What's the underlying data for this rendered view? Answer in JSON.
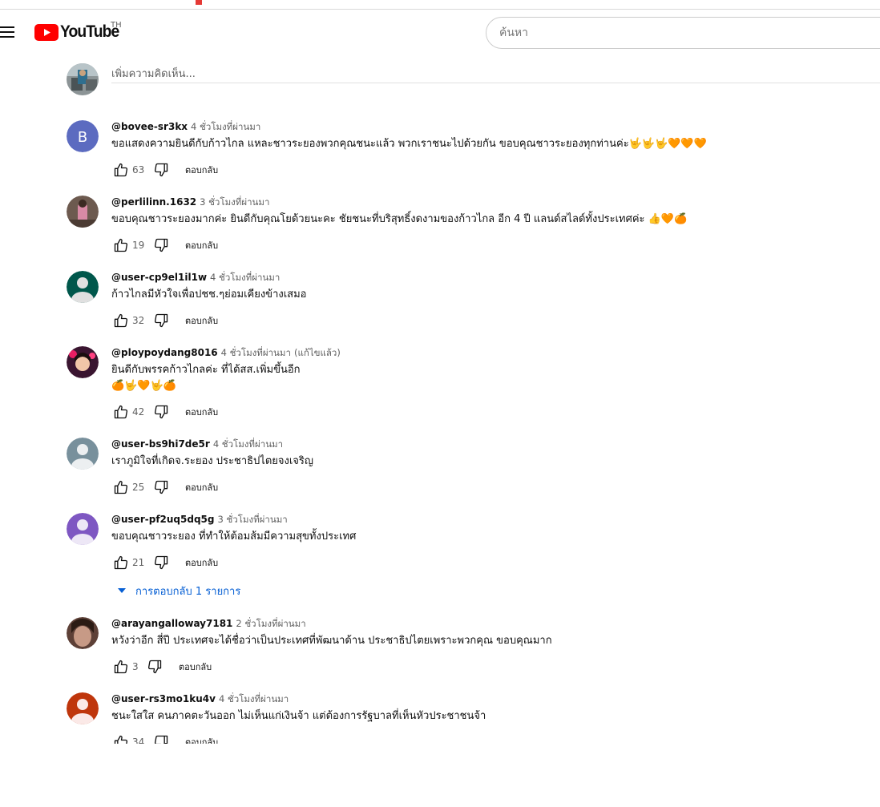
{
  "masthead": {
    "logo_text": "YouTube",
    "country": "TH",
    "search_placeholder": "ค้นหา"
  },
  "add_comment": {
    "placeholder": "เพิ่มความคิดเห็น..."
  },
  "reply_label": "ตอบกลับ",
  "comments": [
    {
      "author": "@bovee-sr3kx",
      "time": "4 ชั่วโมงที่ผ่านมา",
      "avatar_letter": "B",
      "avatar_color": "#5c6bc0",
      "text": "ขอแสดงความยินดีกับก้าวไกล แหละชาวระยองพวกคุณชนะแล้ว พวกเราชนะไปด้วยกัน ขอบคุณชาวระยองทุกท่านค่ะ🤟🤟🤟🧡🧡🧡",
      "likes": "63"
    },
    {
      "author": "@perlilinn.1632",
      "time": "3 ชั่วโมงที่ผ่านมา",
      "avatar_color": "#8d6e63",
      "text": "ขอบคุณชาวระยองมากค่ะ ยินดีกับคุณโยด้วยนะคะ ชัยชนะที่บริสุทธิ์งดงามของก้าวไกล อีก 4 ปี แลนด์สไลด์ทั้งประเทศค่ะ 👍🧡🍊",
      "likes": "19"
    },
    {
      "author": "@user-cp9el1il1w",
      "time": "4 ชั่วโมงที่ผ่านมา",
      "avatar_color": "#00574b",
      "text": "ก้าวไกลมีหัวใจเพื่อปชช.ๆย่อมเคียงข้างเสมอ",
      "likes": "32"
    },
    {
      "author": "@ploypoydang8016",
      "time": "4 ชั่วโมงที่ผ่านมา",
      "edited": "(แก้ไขแล้ว)",
      "avatar_color": "#6a1b4d",
      "text": "ยินดีกับพรรคก้าวไกลค่ะ ที่ได้สส.เพิ่มขึ้นอีก",
      "text2": "🍊🤟🧡🤟🍊",
      "likes": "42"
    },
    {
      "author": "@user-bs9hi7de5r",
      "time": "4 ชั่วโมงที่ผ่านมา",
      "avatar_color": "#78909c",
      "text": "เราภูมิใจที่เกิดจ.ระยอง ประชาธิปไตยจงเจริญ",
      "likes": "25"
    },
    {
      "author": "@user-pf2uq5dq5g",
      "time": "3 ชั่วโมงที่ผ่านมา",
      "avatar_color": "#7e57c2",
      "text": "ขอบคุณชาวระยอง ที่ทำให้ต้อมส้มมีความสุขทั้งประเทศ",
      "likes": "21"
    },
    {
      "author": "@arayangalloway7181",
      "time": "2 ชั่วโมงที่ผ่านมา",
      "avatar_color": "#5d4037",
      "text": "หวังว่าอีก สี่ปี ประเทศจะได้ชื่อว่าเป็นประเทศที่พัฒนาด้าน ประชาธิปไตยเพราะพวกคุณ ขอบคุณมาก",
      "likes": "3"
    },
    {
      "author": "@user-rs3mo1ku4v",
      "time": "4 ชั่วโมงที่ผ่านมา",
      "avatar_color": "#bf360c",
      "text": "ชนะใสใส คนภาคตะวันออก ไม่เห็นแก่เงินจ้า แต่ต้องการรัฐบาลที่เห็นหัวประชาชนจ้า",
      "likes": "34"
    }
  ],
  "replies_toggle": "การตอบกลับ 1 รายการ"
}
